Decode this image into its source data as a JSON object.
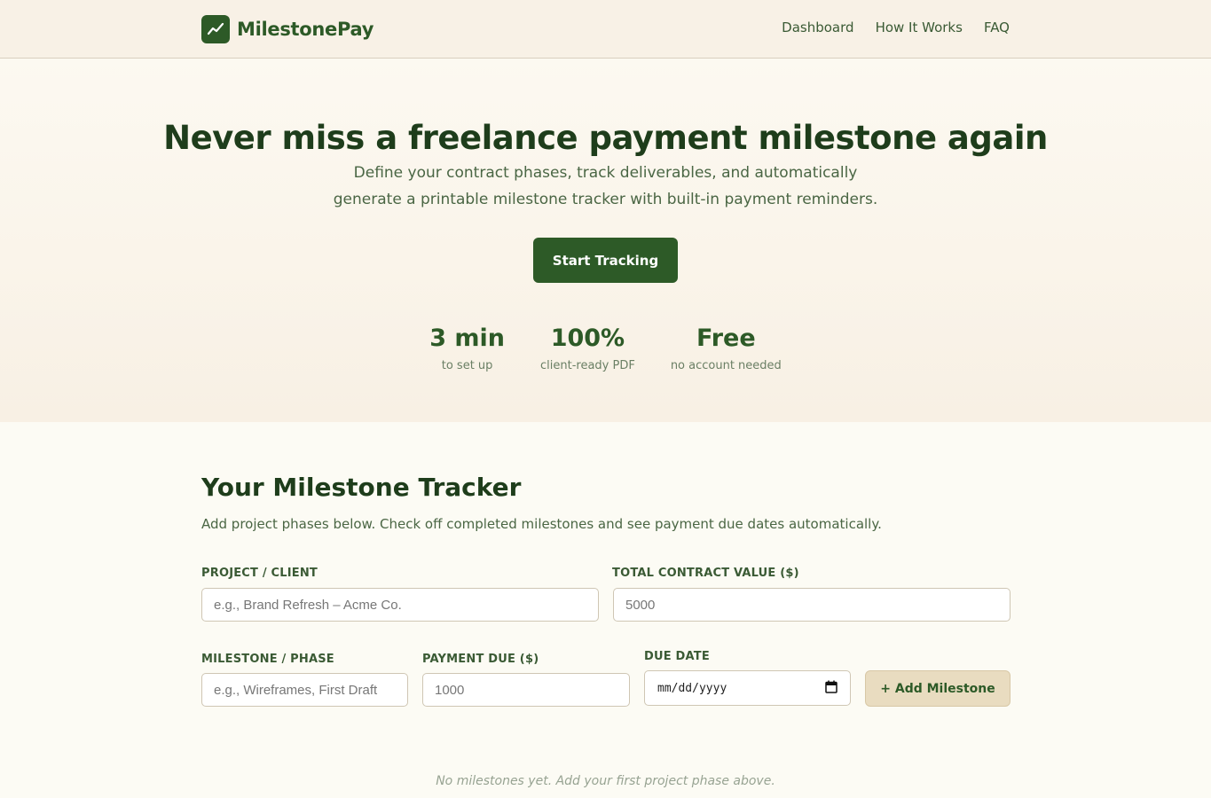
{
  "header": {
    "brand": "MilestonePay",
    "nav": [
      "Dashboard",
      "How It Works",
      "FAQ"
    ]
  },
  "hero": {
    "title": "Never miss a freelance payment milestone again",
    "subtitle": "Define your contract phases, track deliverables, and automatically generate a printable milestone tracker with built-in payment reminders.",
    "cta": "Start Tracking",
    "stats": [
      {
        "value": "3 min",
        "label": "to set up"
      },
      {
        "value": "100%",
        "label": "client-ready PDF"
      },
      {
        "value": "Free",
        "label": "no account needed"
      }
    ]
  },
  "tracker": {
    "title": "Your Milestone Tracker",
    "description": "Add project phases below. Check off completed milestones and see payment due dates automatically.",
    "project": {
      "label": "Project / Client",
      "placeholder": "e.g., Brand Refresh – Acme Co."
    },
    "total": {
      "label": "Total Contract Value ($)",
      "placeholder": "5000"
    },
    "milestone": {
      "label": "Milestone / Phase",
      "placeholder": "e.g., Wireframes, First Draft"
    },
    "payment": {
      "label": "Payment Due ($)",
      "placeholder": "1000"
    },
    "due_date": {
      "label": "Due Date",
      "placeholder": "mm/dd/yyyy"
    },
    "add_button": "+ Add Milestone",
    "empty_message": "No milestones yet. Add your first project phase above."
  },
  "colors": {
    "brand": "#2d5a27",
    "header_bg": "#f8f1e6",
    "add_button_bg": "#e9dcc0"
  },
  "icons": {
    "logo": "trending-up-icon",
    "date_picker": "calendar-icon"
  }
}
